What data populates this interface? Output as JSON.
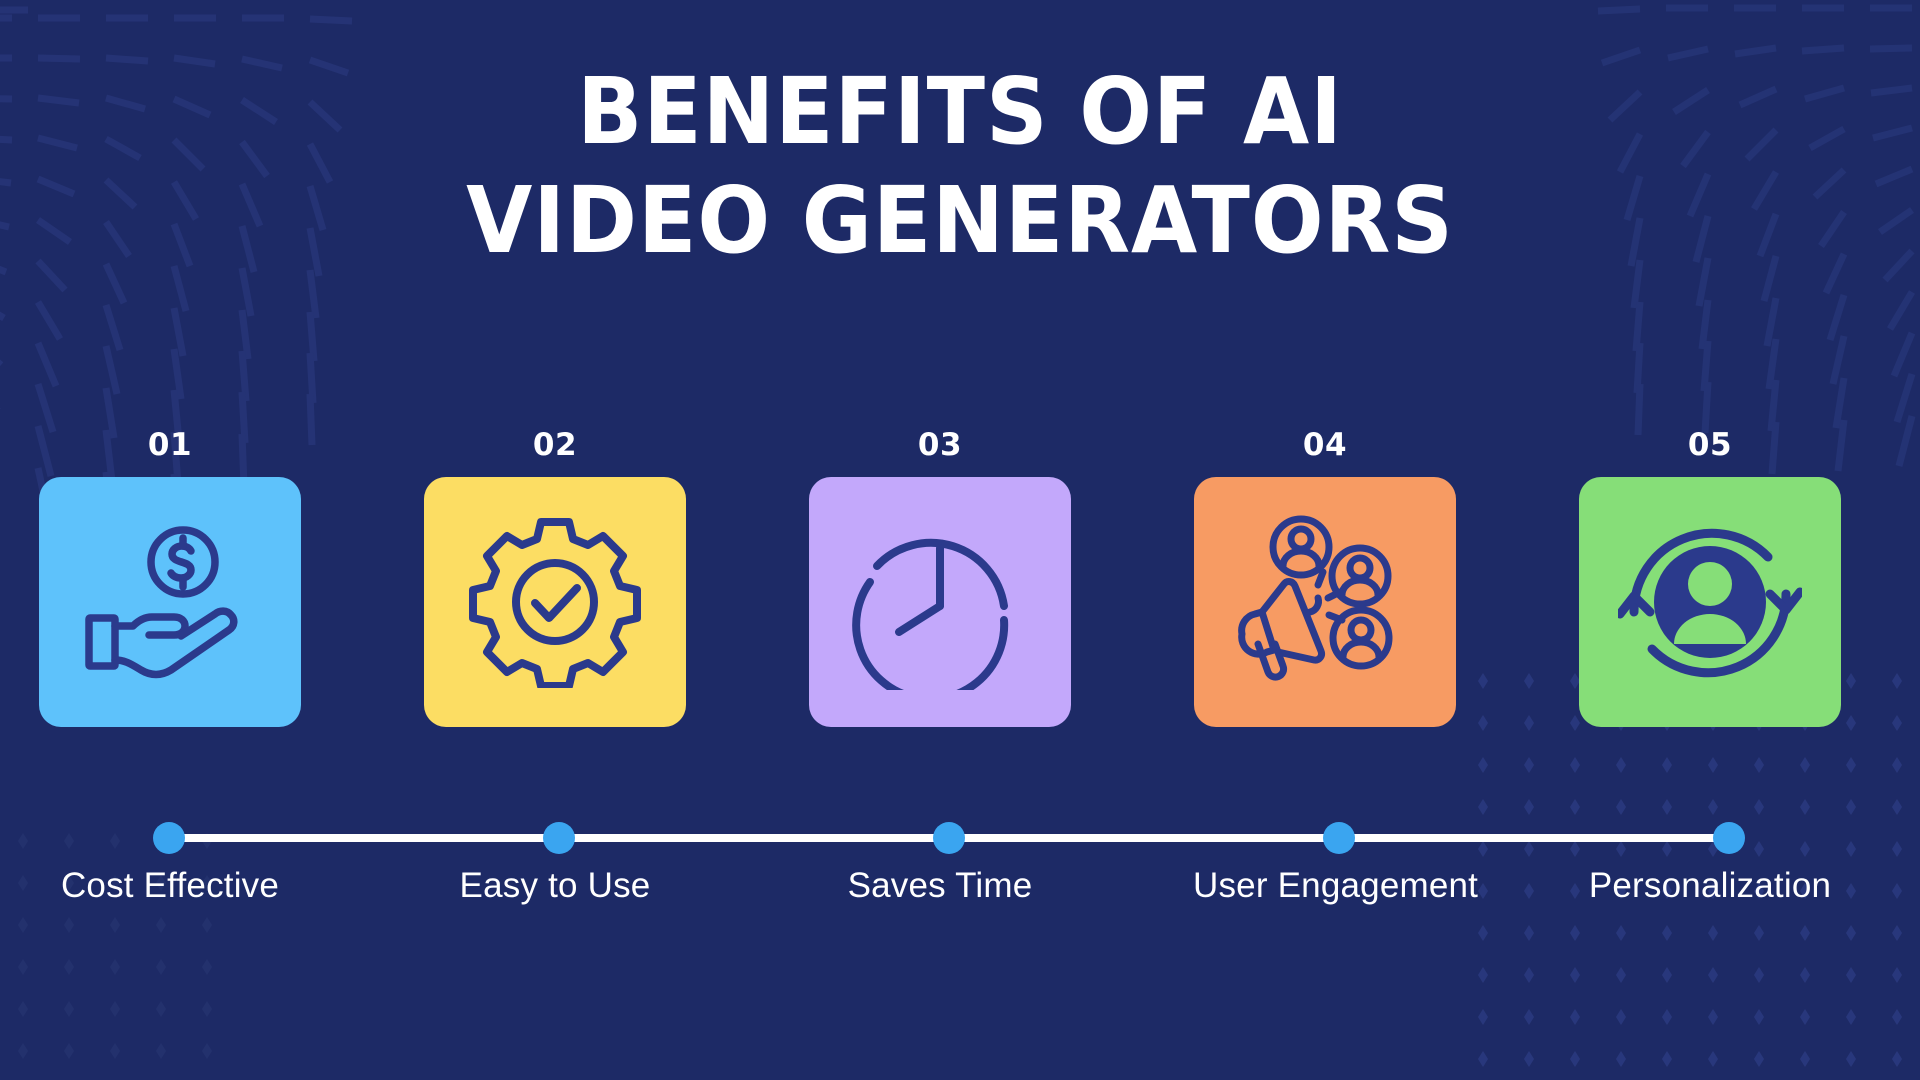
{
  "theme": {
    "background_color": "#1d2a66",
    "title_color": "#ffffff",
    "timeline_line_color": "#ffffff",
    "timeline_dot_color": "#3aa5f0",
    "icon_stroke_color": "#2b3a8c"
  },
  "header": {
    "title_line_1": "BENEFITS OF AI",
    "title_line_2": "VIDEO GENERATORS"
  },
  "steps": [
    {
      "number": "01",
      "label": "Cost Effective",
      "card_color": "#5ec2fb",
      "icon": "hand-holding-money-icon"
    },
    {
      "number": "02",
      "label": "Easy to Use",
      "card_color": "#fcdd63",
      "icon": "gear-check-icon"
    },
    {
      "number": "03",
      "label": "Saves Time",
      "card_color": "#c3a8fb",
      "icon": "clock-icon"
    },
    {
      "number": "04",
      "label": "User Engagement",
      "card_color": "#f79b63",
      "icon": "megaphone-users-icon"
    },
    {
      "number": "05",
      "label": "Personalization",
      "card_color": "#86de78",
      "icon": "user-refresh-icon"
    }
  ]
}
